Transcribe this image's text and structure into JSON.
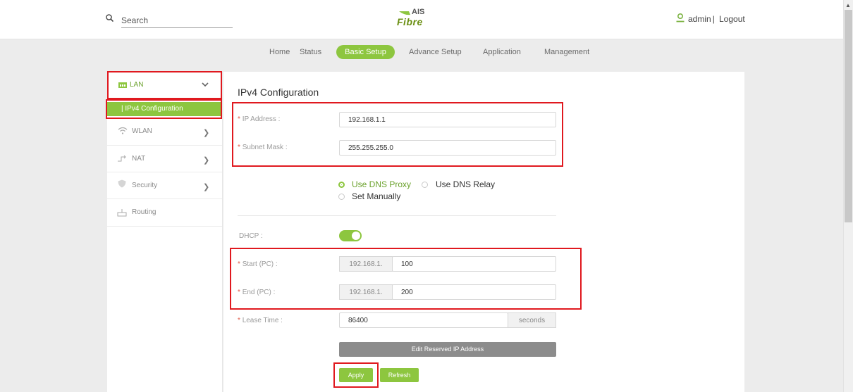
{
  "header": {
    "search_placeholder": "Search",
    "logo_ais": "AIS",
    "logo_fibre": "Fibre",
    "user_name": "admin",
    "logout_label": "Logout",
    "separator": "|"
  },
  "nav": {
    "items": [
      {
        "label": "Home"
      },
      {
        "label": "Status"
      },
      {
        "label": "Basic Setup",
        "active": true
      },
      {
        "label": "Advance Setup"
      },
      {
        "label": "Application"
      },
      {
        "label": "Management"
      }
    ]
  },
  "sidebar": {
    "items": [
      {
        "label": "LAN",
        "icon": "lan-icon",
        "expanded": true
      },
      {
        "label": "WLAN",
        "icon": "wifi-icon"
      },
      {
        "label": "NAT",
        "icon": "nat-icon"
      },
      {
        "label": "Security",
        "icon": "shield-icon"
      },
      {
        "label": "Routing",
        "icon": "router-icon"
      }
    ],
    "subitem_active": "| IPv4 Configuration"
  },
  "main": {
    "title": "IPv4 Configuration",
    "ip_address_label": "IP Address :",
    "ip_address_value": "192.168.1.1",
    "subnet_mask_label": "Subnet Mask :",
    "subnet_mask_value": "255.255.255.0",
    "dns_options": {
      "use_dns_proxy": "Use DNS Proxy",
      "use_dns_relay": "Use DNS Relay",
      "set_manually": "Set Manually",
      "selected": "Use DNS Proxy"
    },
    "dhcp_label": "DHCP :",
    "dhcp_enabled": true,
    "start_label": "Start (PC) :",
    "start_prefix": "192.168.1.",
    "start_value": "100",
    "end_label": "End (PC) :",
    "end_prefix": "192.168.1.",
    "end_value": "200",
    "lease_label": "Lease Time :",
    "lease_value": "86400",
    "lease_unit": "seconds",
    "required_mark": "*",
    "edit_reserved_label": "Edit Reserved IP Address",
    "apply_label": "Apply",
    "refresh_label": "Refresh"
  },
  "colors": {
    "accent": "#8dc63f",
    "highlight": "#e0191f"
  }
}
